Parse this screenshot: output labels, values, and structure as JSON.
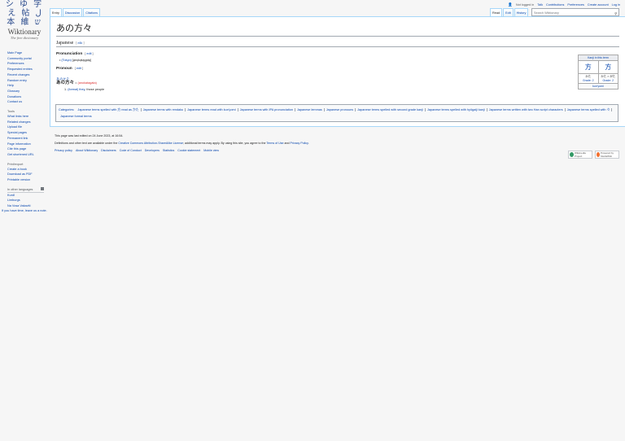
{
  "logo": {
    "glyphs": "シ ゆ 字 え 帖 ل 本 維 ש",
    "name": "Wiktionary",
    "tagline": "The free dictionary"
  },
  "sidebar": {
    "nav": [
      "Main Page",
      "Community portal",
      "Preferences",
      "Requested entries",
      "Recent changes",
      "Random entry",
      "Help",
      "Glossary",
      "Donations",
      "Contact us"
    ],
    "tools_heading": "Tools",
    "tools": [
      "What links here",
      "Related changes",
      "Upload file",
      "Special pages",
      "Permanent link",
      "Page information",
      "Cite this page",
      "Get shortened URL"
    ],
    "print_heading": "Print/export",
    "print": [
      "Create a book",
      "Download as PDF",
      "Printable version"
    ],
    "lang_heading": "In other languages",
    "langs": [
      "Kurdî",
      "Limburgs",
      "Na Vosa Vakaviti"
    ],
    "note": "If you have time, leave us a note."
  },
  "personal": {
    "status": "Not logged in",
    "links": [
      "Talk",
      "Contributions",
      "Preferences",
      "Create account",
      "Log in"
    ]
  },
  "tabs": {
    "left": [
      "Entry",
      "Discussion",
      "Citations"
    ],
    "right": [
      "Read",
      "Edit",
      "History"
    ]
  },
  "search": {
    "placeholder": "Search Wiktionary"
  },
  "page": {
    "title": "あの方々",
    "lang": "Japanese",
    "edit": "edit",
    "pron_heading": "Pronunciation",
    "pron_label": "(Tokyo)",
    "pron_ipa": "[a̠no̞ka̠ta̠ga̠ta̠]",
    "pos_heading": "Pronoun",
    "headword": "あの方",
    "headword_mark": "々",
    "headword_ruby": "あのかた",
    "romaji_sep": "•",
    "romaji": "(anokatagata)",
    "def_num": "1.",
    "def_label": "(formal)",
    "def_link": "they",
    "def_text": ", those people"
  },
  "kanji_box": {
    "caption": "Kanji in this term",
    "kanji": [
      "方",
      "方"
    ],
    "readings": [
      "かた",
      "かた > がた"
    ],
    "grades": [
      "Grade: 2",
      "Grade: 2"
    ],
    "footer": "kun'yomi"
  },
  "categories": {
    "label": "Categories:",
    "items": [
      "Japanese terms spelled with 方 read as かた",
      "Japanese terms with rendaku",
      "Japanese terms read with kun'yomi",
      "Japanese terms with IPA pronunciation",
      "Japanese lemmas",
      "Japanese pronouns",
      "Japanese terms spelled with second grade kanji",
      "Japanese terms spelled with hyōgaiji kanji",
      "Japanese terms written with two Han script characters",
      "Japanese terms spelled with 々",
      "Japanese formal terms"
    ]
  },
  "footer": {
    "last_edited": "This page was last edited on 24 June 2023, at 16:54.",
    "license_pre": "Definitions and other text are available under the ",
    "license_link": "Creative Commons Attribution-ShareAlike License",
    "license_mid": "; additional terms may apply. By using this site, you agree to the ",
    "terms": "Terms of Use",
    "and": " and ",
    "privacy": "Privacy Policy",
    "end": ".",
    "links": [
      "Privacy policy",
      "About Wiktionary",
      "Disclaimers",
      "Code of Conduct",
      "Developers",
      "Statistics",
      "Cookie statement",
      "Mobile view"
    ],
    "badges": [
      "Wikimedia Project",
      "Powered by MediaWiki"
    ]
  }
}
